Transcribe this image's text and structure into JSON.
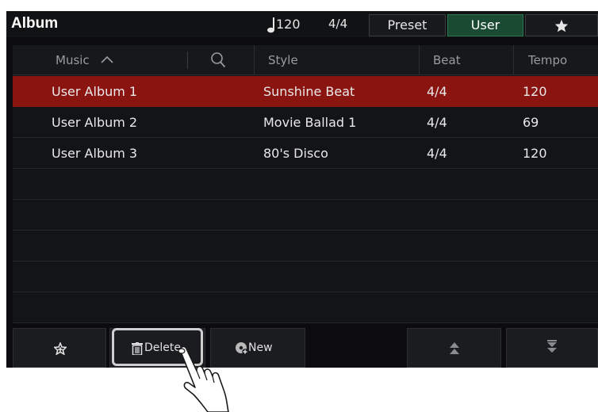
{
  "title": "Album",
  "tempo": "120",
  "meter": "4/4",
  "tabs": {
    "preset": "Preset",
    "user": "User"
  },
  "header": {
    "music": "Music",
    "style": "Style",
    "beat": "Beat",
    "tempo": "Tempo"
  },
  "rows": [
    {
      "name": "User Album 1",
      "style": "Sunshine Beat",
      "beat": "4/4",
      "tempo": "120",
      "selected": true
    },
    {
      "name": "User Album 2",
      "style": "Movie Ballad 1",
      "beat": "4/4",
      "tempo": "69",
      "selected": false
    },
    {
      "name": "User Album 3",
      "style": "80's Disco",
      "beat": "4/4",
      "tempo": "120",
      "selected": false
    },
    {
      "name": "",
      "style": "",
      "beat": "",
      "tempo": "",
      "selected": false
    },
    {
      "name": "",
      "style": "",
      "beat": "",
      "tempo": "",
      "selected": false
    },
    {
      "name": "",
      "style": "",
      "beat": "",
      "tempo": "",
      "selected": false
    },
    {
      "name": "",
      "style": "",
      "beat": "",
      "tempo": "",
      "selected": false
    },
    {
      "name": "",
      "style": "",
      "beat": "",
      "tempo": "",
      "selected": false
    }
  ],
  "toolbar": {
    "delete_label": "Delete",
    "new_label": "New"
  },
  "icons": {
    "note": "quarter-note-icon",
    "sort": "chevron-up-icon",
    "search": "search-icon",
    "favorite_tab": "star-icon",
    "add_favorite": "star-plus-icon",
    "delete": "trash-icon",
    "new": "add-disk-icon",
    "page_up": "double-chevron-up-icon",
    "page_down": "double-chevron-down-icon",
    "cursor": "hand-pointer-icon"
  },
  "colors": {
    "selected_row": "#8a1410",
    "active_tab": "#1a4a32",
    "background": "#0c0c0e"
  }
}
